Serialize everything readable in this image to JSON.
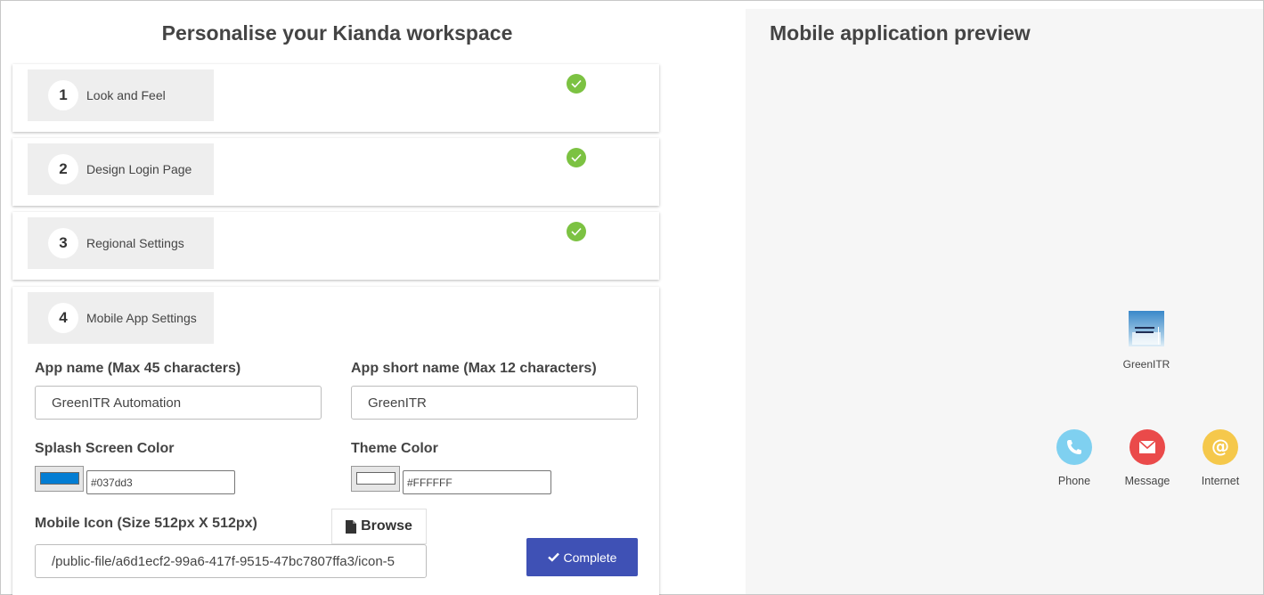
{
  "title": "Personalise your Kianda workspace",
  "steps": [
    {
      "number": "1",
      "label": "Look and Feel",
      "completed": true
    },
    {
      "number": "2",
      "label": "Design Login Page",
      "completed": true
    },
    {
      "number": "3",
      "label": "Regional Settings",
      "completed": true
    },
    {
      "number": "4",
      "label": "Mobile App Settings",
      "completed": false
    }
  ],
  "form": {
    "app_name_label": "App name (Max 45 characters)",
    "app_name_value": "GreenITR Automation",
    "app_short_name_label": "App short name (Max 12 characters)",
    "app_short_name_value": "GreenITR",
    "splash_color_label": "Splash Screen Color",
    "splash_color_value": "#037dd3",
    "theme_color_label": "Theme Color",
    "theme_color_value": "#FFFFFF",
    "mobile_icon_label": "Mobile Icon (Size 512px X 512px)",
    "mobile_icon_value": "/public-file/a6d1ecf2-99a6-417f-9515-47bc7807ffa3/icon-5",
    "browse_label": "Browse",
    "complete_label": "Complete"
  },
  "preview": {
    "title": "Mobile application preview",
    "app_label": "GreenITR",
    "contacts": [
      {
        "label": "Phone",
        "icon": "phone-icon",
        "color": "#7fd0f0"
      },
      {
        "label": "Message",
        "icon": "envelope-icon",
        "color": "#ea4a4a"
      },
      {
        "label": "Internet",
        "icon": "at-icon",
        "color": "#f5c84b"
      }
    ]
  },
  "colors": {
    "check": "#7cc242",
    "primary_button": "#3f51b5",
    "splash": "#037dd3"
  }
}
